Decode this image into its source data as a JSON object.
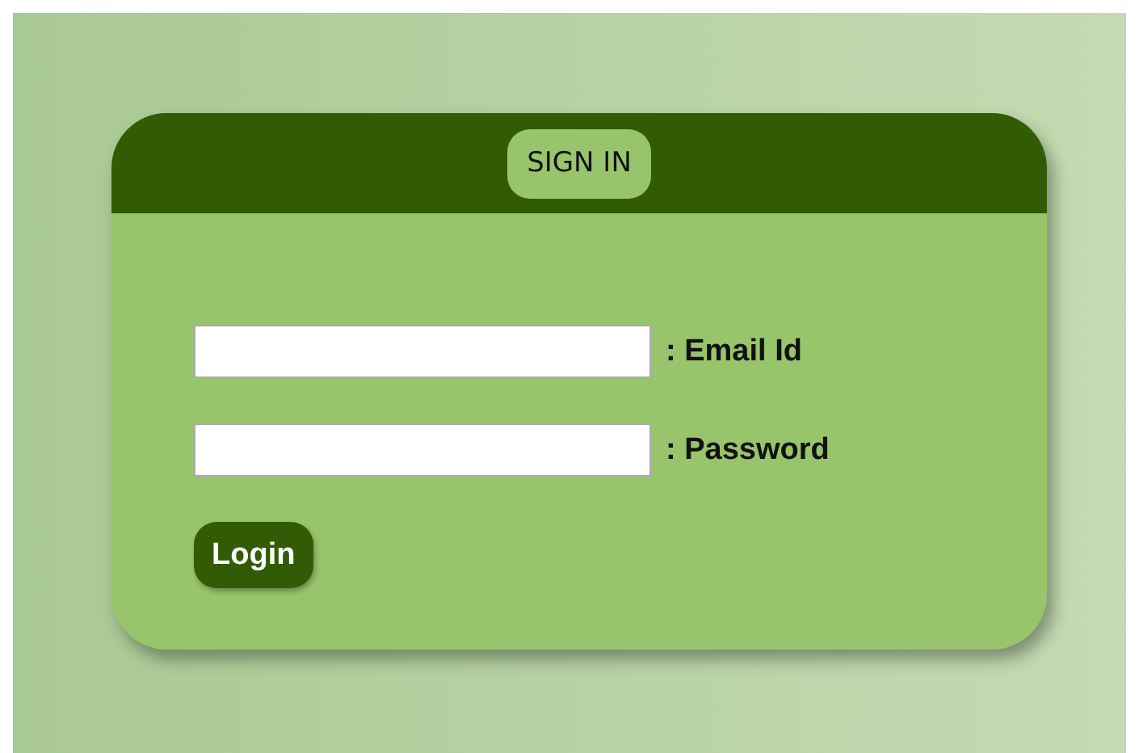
{
  "card": {
    "title": "SIGN IN"
  },
  "fields": [
    {
      "label": ": Email Id"
    },
    {
      "label": ": Password"
    }
  ],
  "buttons": [
    "Login"
  ]
}
